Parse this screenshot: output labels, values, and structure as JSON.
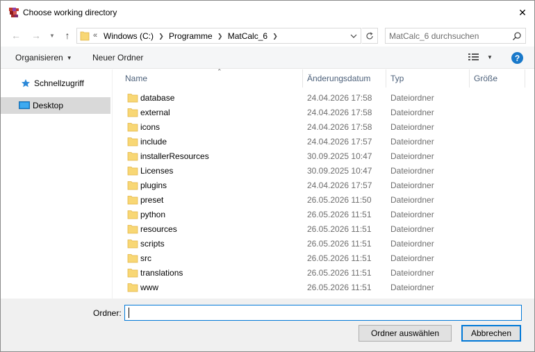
{
  "window": {
    "title": "Choose working directory",
    "close_symbol": "✕"
  },
  "address": {
    "overflow_symbol": "«",
    "crumbs": [
      "Windows (C:)",
      "Programme",
      "MatCalc_6"
    ],
    "search_placeholder": "MatCalc_6 durchsuchen"
  },
  "toolbar": {
    "organize_label": "Organisieren",
    "new_folder_label": "Neuer Ordner",
    "help_label": "?"
  },
  "nav": {
    "items": [
      {
        "label": "Schnellzugriff",
        "icon": "star-icon"
      },
      {
        "label": "Desktop",
        "icon": "desktop-icon",
        "selected": true
      }
    ]
  },
  "columns": [
    "Name",
    "Änderungsdatum",
    "Typ",
    "Größe"
  ],
  "files": [
    {
      "name": "database",
      "date": "24.04.2026 17:58",
      "type": "Dateiordner"
    },
    {
      "name": "external",
      "date": "24.04.2026 17:58",
      "type": "Dateiordner"
    },
    {
      "name": "icons",
      "date": "24.04.2026 17:58",
      "type": "Dateiordner"
    },
    {
      "name": "include",
      "date": "24.04.2026 17:57",
      "type": "Dateiordner"
    },
    {
      "name": "installerResources",
      "date": "30.09.2025 10:47",
      "type": "Dateiordner"
    },
    {
      "name": "Licenses",
      "date": "30.09.2025 10:47",
      "type": "Dateiordner"
    },
    {
      "name": "plugins",
      "date": "24.04.2026 17:57",
      "type": "Dateiordner"
    },
    {
      "name": "preset",
      "date": "26.05.2026 11:50",
      "type": "Dateiordner"
    },
    {
      "name": "python",
      "date": "26.05.2026 11:51",
      "type": "Dateiordner"
    },
    {
      "name": "resources",
      "date": "26.05.2026 11:51",
      "type": "Dateiordner"
    },
    {
      "name": "scripts",
      "date": "26.05.2026 11:51",
      "type": "Dateiordner"
    },
    {
      "name": "src",
      "date": "26.05.2026 11:51",
      "type": "Dateiordner"
    },
    {
      "name": "translations",
      "date": "26.05.2026 11:51",
      "type": "Dateiordner"
    },
    {
      "name": "www",
      "date": "26.05.2026 11:51",
      "type": "Dateiordner"
    }
  ],
  "footer": {
    "folder_label": "Ordner:",
    "folder_value": "",
    "select_button": "Ordner auswählen",
    "cancel_button": "Abbrechen"
  },
  "colors": {
    "folder": "#f8d775",
    "accent": "#0078d7",
    "help": "#1979ca"
  }
}
